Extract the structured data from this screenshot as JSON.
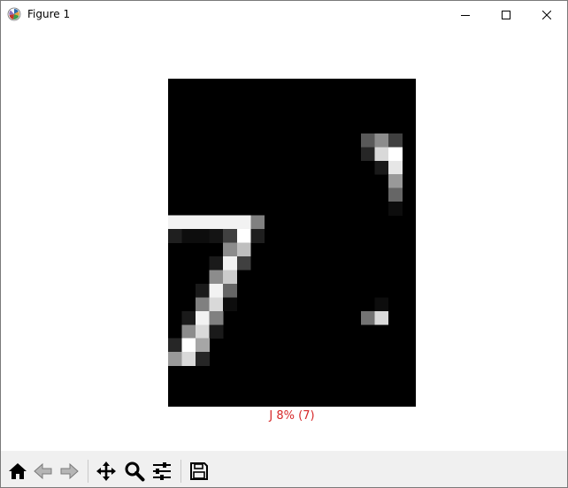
{
  "window": {
    "title": "Figure 1",
    "icons": {
      "app": "matplotlib-icon",
      "minimize": "minimize-icon",
      "maximize": "maximize-icon",
      "close": "close-icon"
    }
  },
  "figure": {
    "caption": "J  8% (7)",
    "caption_color": "#d62728",
    "image_rows": 24,
    "image_cols": 18,
    "image": [
      [
        0,
        0,
        0,
        0,
        0,
        0,
        0,
        0,
        0,
        0,
        0,
        0,
        0,
        0,
        0,
        0,
        0,
        0
      ],
      [
        0,
        0,
        0,
        0,
        0,
        0,
        0,
        0,
        0,
        0,
        0,
        0,
        0,
        0,
        0,
        0,
        0,
        0
      ],
      [
        0,
        0,
        0,
        0,
        0,
        0,
        0,
        0,
        0,
        0,
        0,
        0,
        0,
        0,
        0,
        0,
        0,
        0
      ],
      [
        0,
        0,
        0,
        0,
        0,
        0,
        0,
        0,
        0,
        0,
        0,
        0,
        0,
        0,
        0,
        0,
        0,
        0
      ],
      [
        0,
        0,
        0,
        0,
        0,
        0,
        0,
        0,
        0,
        0,
        0,
        0,
        0,
        0,
        0.35,
        0.55,
        0.25,
        0
      ],
      [
        0,
        0,
        0,
        0,
        0,
        0,
        0,
        0,
        0,
        0,
        0,
        0,
        0,
        0,
        0.15,
        0.85,
        1,
        0
      ],
      [
        0,
        0,
        0,
        0,
        0,
        0,
        0,
        0,
        0,
        0,
        0,
        0,
        0,
        0,
        0,
        0.1,
        0.9,
        0
      ],
      [
        0,
        0,
        0,
        0,
        0,
        0,
        0,
        0,
        0,
        0,
        0,
        0,
        0,
        0,
        0,
        0,
        0.6,
        0
      ],
      [
        0,
        0,
        0,
        0,
        0,
        0,
        0,
        0,
        0,
        0,
        0,
        0,
        0,
        0,
        0,
        0,
        0.4,
        0
      ],
      [
        0,
        0,
        0,
        0,
        0,
        0,
        0,
        0,
        0,
        0,
        0,
        0,
        0,
        0,
        0,
        0,
        0.05,
        0
      ],
      [
        0.95,
        0.95,
        0.95,
        0.95,
        0.95,
        0.95,
        0.5,
        0,
        0,
        0,
        0,
        0,
        0,
        0,
        0,
        0,
        0,
        0
      ],
      [
        0.12,
        0.05,
        0.05,
        0.08,
        0.25,
        1,
        0.12,
        0,
        0,
        0,
        0,
        0,
        0,
        0,
        0,
        0,
        0,
        0
      ],
      [
        0,
        0,
        0,
        0,
        0.55,
        0.75,
        0,
        0,
        0,
        0,
        0,
        0,
        0,
        0,
        0,
        0,
        0,
        0
      ],
      [
        0,
        0,
        0,
        0.1,
        0.95,
        0.25,
        0,
        0,
        0,
        0,
        0,
        0,
        0,
        0,
        0,
        0,
        0,
        0
      ],
      [
        0,
        0,
        0,
        0.55,
        0.8,
        0,
        0,
        0,
        0,
        0,
        0,
        0,
        0,
        0,
        0,
        0,
        0,
        0
      ],
      [
        0,
        0,
        0.1,
        0.95,
        0.4,
        0,
        0,
        0,
        0,
        0,
        0,
        0,
        0,
        0,
        0,
        0,
        0,
        0
      ],
      [
        0,
        0,
        0.5,
        0.85,
        0.05,
        0,
        0,
        0,
        0,
        0,
        0,
        0,
        0,
        0,
        0,
        0.05,
        0,
        0
      ],
      [
        0,
        0.1,
        0.95,
        0.5,
        0,
        0,
        0,
        0,
        0,
        0,
        0,
        0,
        0,
        0,
        0.45,
        0.85,
        0,
        0
      ],
      [
        0,
        0.55,
        0.85,
        0.1,
        0,
        0,
        0,
        0,
        0,
        0,
        0,
        0,
        0,
        0,
        0,
        0,
        0,
        0
      ],
      [
        0.15,
        1,
        0.65,
        0,
        0,
        0,
        0,
        0,
        0,
        0,
        0,
        0,
        0,
        0,
        0,
        0,
        0,
        0
      ],
      [
        0.6,
        0.85,
        0.15,
        0,
        0,
        0,
        0,
        0,
        0,
        0,
        0,
        0,
        0,
        0,
        0,
        0,
        0,
        0
      ],
      [
        0,
        0,
        0,
        0,
        0,
        0,
        0,
        0,
        0,
        0,
        0,
        0,
        0,
        0,
        0,
        0,
        0,
        0
      ],
      [
        0,
        0,
        0,
        0,
        0,
        0,
        0,
        0,
        0,
        0,
        0,
        0,
        0,
        0,
        0,
        0,
        0,
        0
      ],
      [
        0,
        0,
        0,
        0,
        0,
        0,
        0,
        0,
        0,
        0,
        0,
        0,
        0,
        0,
        0,
        0,
        0,
        0
      ]
    ]
  },
  "toolbar": {
    "buttons": [
      {
        "name": "home-button",
        "icon": "home-icon"
      },
      {
        "name": "back-button",
        "icon": "back-arrow-icon"
      },
      {
        "name": "forward-button",
        "icon": "forward-arrow-icon"
      },
      {
        "name": "pan-button",
        "icon": "move-icon"
      },
      {
        "name": "zoom-button",
        "icon": "magnifier-icon"
      },
      {
        "name": "configure-subplots-button",
        "icon": "sliders-icon"
      },
      {
        "name": "save-button",
        "icon": "floppy-disk-icon"
      }
    ]
  }
}
